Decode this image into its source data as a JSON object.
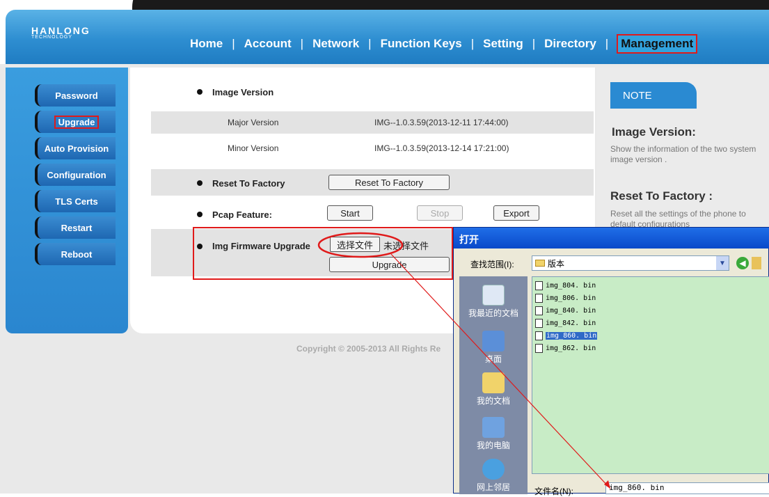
{
  "header": {
    "logo_main": "HANLONG",
    "logo_sub": "TECHNOLOGY",
    "nav": [
      {
        "label": "Home"
      },
      {
        "label": "Account"
      },
      {
        "label": "Network"
      },
      {
        "label": "Function Keys"
      },
      {
        "label": "Setting"
      },
      {
        "label": "Directory"
      },
      {
        "label": "Management"
      }
    ],
    "separator": "|"
  },
  "sidebar": {
    "items": [
      {
        "label": "Password"
      },
      {
        "label": "Upgrade"
      },
      {
        "label": "Auto Provision"
      },
      {
        "label": "Configuration"
      },
      {
        "label": "TLS Certs"
      },
      {
        "label": "Restart"
      },
      {
        "label": "Reboot"
      }
    ]
  },
  "main": {
    "image_version": {
      "title": "Image Version",
      "major_label": "Major Version",
      "major_value": "IMG--1.0.3.59(2013-12-11 17:44:00)",
      "minor_label": "Minor Version",
      "minor_value": "IMG--1.0.3.59(2013-12-14 17:21:00)"
    },
    "reset": {
      "title": "Reset To Factory",
      "button": "Reset To Factory"
    },
    "pcap": {
      "title": "Pcap Feature:",
      "start": "Start",
      "stop": "Stop",
      "export": "Export"
    },
    "img_upgrade": {
      "title": "Img Firmware Upgrade",
      "choose_file": "选择文件",
      "no_file": "未选择文件",
      "upgrade": "Upgrade"
    },
    "copyright": "Copyright © 2005-2013 All Rights Re"
  },
  "note": {
    "tag": "NOTE",
    "h1": "Image Version:",
    "t1": "Show the information of the two system image version .",
    "h2": "Reset To Factory :",
    "t2": "Reset all the settings of the phone to default configurations"
  },
  "dialog": {
    "title": "打开",
    "look_in_label": "查找范围(I):",
    "look_in_value": "版本",
    "places": [
      {
        "label": "我最近的文档"
      },
      {
        "label": "桌面"
      },
      {
        "label": "我的文档"
      },
      {
        "label": "我的电脑"
      },
      {
        "label": "网上邻居"
      }
    ],
    "files": [
      {
        "name": "img_804. bin"
      },
      {
        "name": "img_806. bin"
      },
      {
        "name": "img_840. bin"
      },
      {
        "name": "img_842. bin"
      },
      {
        "name": "img_860. bin"
      },
      {
        "name": "img_862. bin"
      }
    ],
    "selected_file": "img_860. bin",
    "filename_label": "文件名(N):",
    "filename_value": "img_860. bin"
  },
  "colors": {
    "header": "#2e8ed1",
    "highlight": "#e01a1a",
    "filelist_bg": "#c8ecc6"
  }
}
